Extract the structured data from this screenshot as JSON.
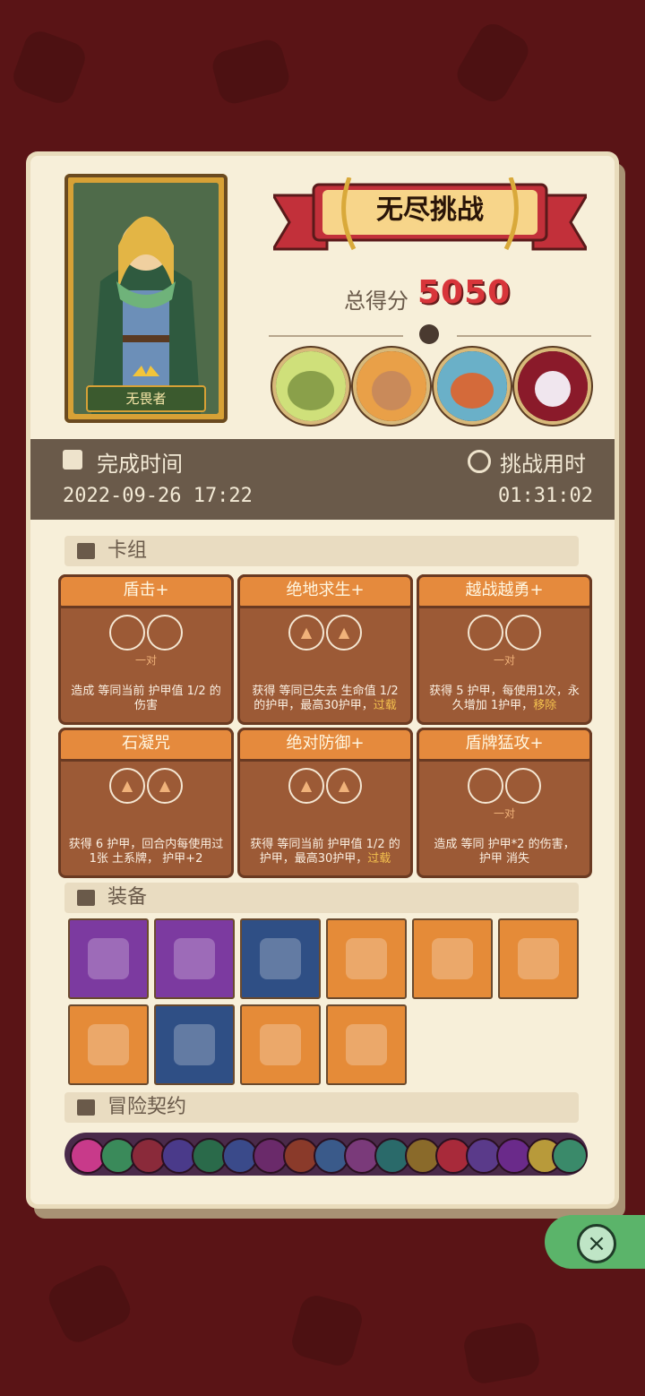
{
  "hero": {
    "name": "无畏者"
  },
  "mode": {
    "title": "无尽挑战"
  },
  "score": {
    "label": "总得分",
    "value": "5050"
  },
  "bosses": [
    "boss-1",
    "boss-2",
    "boss-3",
    "boss-4"
  ],
  "info": {
    "finish_label": "完成时间",
    "finish_value": "2022-09-26 17:22",
    "duration_label": "挑战用时",
    "duration_value": "01:31:02"
  },
  "sections": {
    "deck": "卡组",
    "equipment": "装备",
    "contracts": "冒险契约"
  },
  "cards": [
    {
      "title": "盾击+",
      "sub": "一对",
      "desc": "造成 等同当前 护甲值 1/2 的伤害",
      "highlight": ""
    },
    {
      "title": "绝地求生+",
      "sub": "",
      "desc": "获得 等同已失去 生命值 1/2 的护甲，最高30护甲，",
      "highlight": "过载"
    },
    {
      "title": "越战越勇+",
      "sub": "一对",
      "desc": "获得 5 护甲，每使用1次，永久增加 1护甲，",
      "highlight": "移除"
    },
    {
      "title": "石凝咒",
      "sub": "",
      "desc": "获得 6 护甲，回合内每使用过1张 土系牌， 护甲+2",
      "highlight": ""
    },
    {
      "title": "绝对防御+",
      "sub": "",
      "desc": "获得 等同当前 护甲值 1/2 的护甲，最高30护甲，",
      "highlight": "过载"
    },
    {
      "title": "盾牌猛攻+",
      "sub": "一对",
      "desc": "造成 等同 护甲*2 的伤害， 护甲 消失",
      "highlight": ""
    }
  ],
  "colors": {
    "accent": "#d8353a",
    "panel": "#f7efd9",
    "card": "#9c5a36",
    "card_title": "#e58a3d",
    "close": "#5bb46a"
  }
}
